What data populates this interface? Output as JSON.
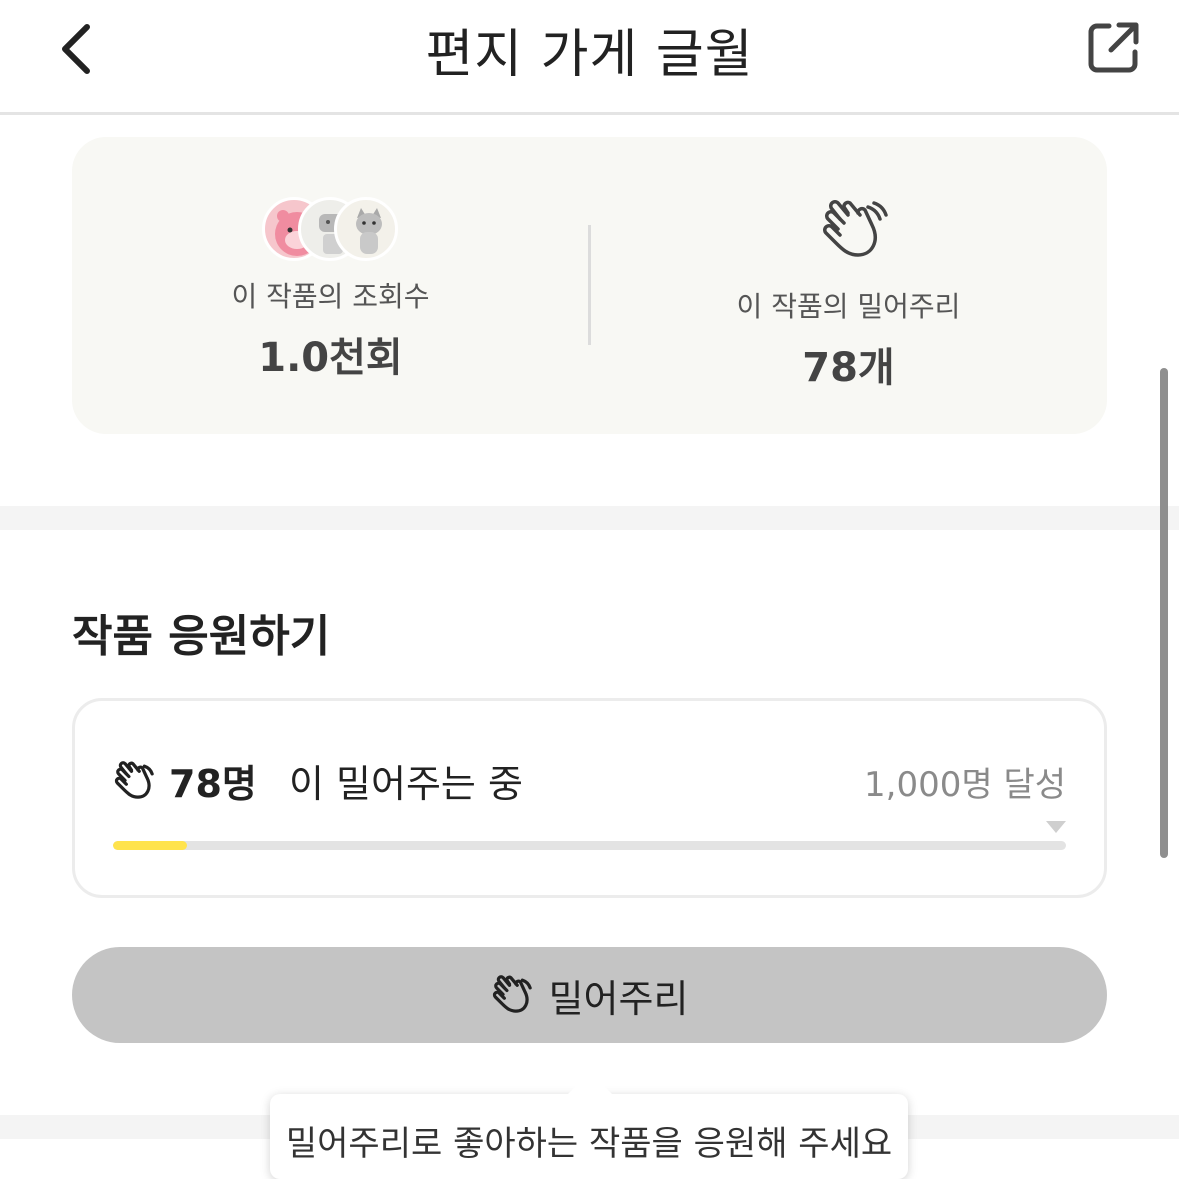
{
  "header": {
    "title": "편지 가게 글월",
    "back_icon": "chevron-left-icon",
    "share_icon": "external-link-icon"
  },
  "stats": {
    "views_label": "이 작품의 조회수",
    "views_value": "1.0천회",
    "claps_label": "이 작품의 밀어주리",
    "claps_value": "78개",
    "avatar_icons": [
      "pink-beaver-avatar",
      "gray-character-avatar",
      "gray-cat-avatar"
    ]
  },
  "support": {
    "section_title": "작품 응원하기",
    "count_strong": "78명",
    "count_rest": "이 밀어주는 중",
    "goal_text": "1,000명 달성",
    "progress": 0.078,
    "accent_color": "#ffe34d"
  },
  "push_button": {
    "label": "밀어주리",
    "icon": "clap-icon"
  },
  "tooltip": {
    "text": "밀어주리로 좋아하는 작품을 응원해 주세요"
  }
}
